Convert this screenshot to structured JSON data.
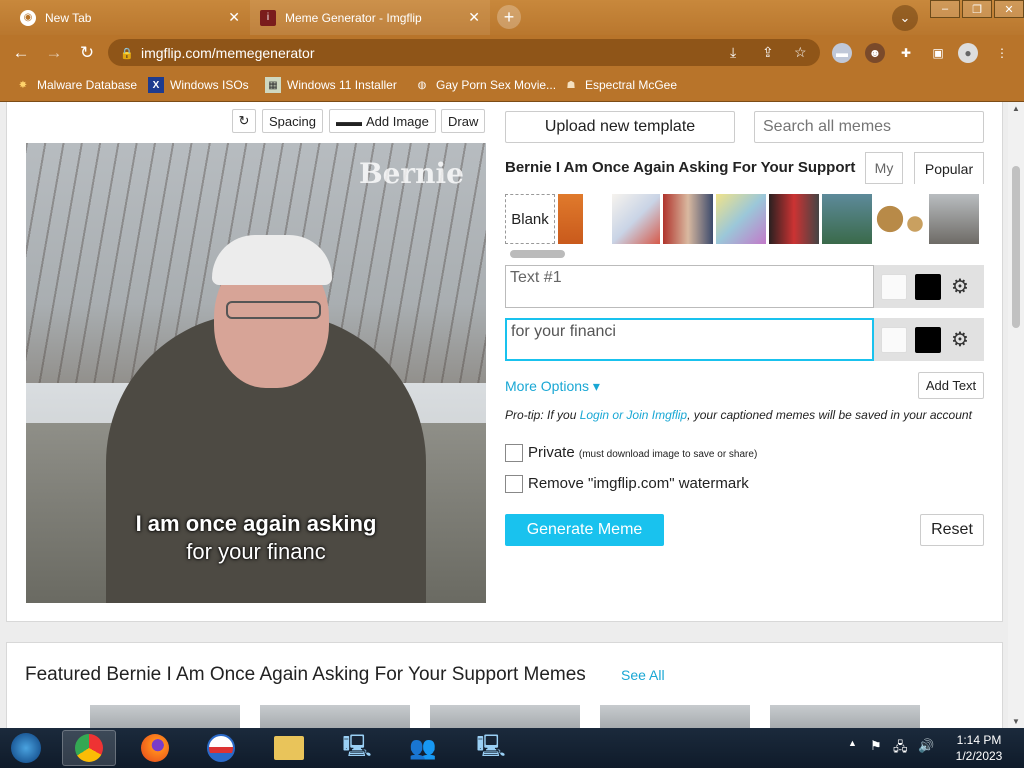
{
  "browser": {
    "tabs": [
      {
        "title": "New Tab"
      },
      {
        "title": "Meme Generator - Imgflip"
      }
    ],
    "url": "imgflip.com/memegenerator",
    "bookmarks": [
      {
        "label": "Malware Database"
      },
      {
        "label": "Windows ISOs"
      },
      {
        "label": "Windows 11 Installer"
      },
      {
        "label": "Gay Porn Sex Movie..."
      },
      {
        "label": "Espectral McGee"
      }
    ]
  },
  "editor": {
    "tools": {
      "spacing": "Spacing",
      "add_image": "Add Image",
      "draw": "Draw"
    },
    "meme_watermark_logo": "Bernie",
    "caption_line1": "I am once again asking",
    "caption_line2": "for your financ",
    "upload_label": "Upload new template",
    "search_placeholder": "Search all memes",
    "template_name": "Bernie I Am Once Again Asking For Your Support",
    "tab_my": "My",
    "tab_popular": "Popular",
    "blank_label": "Blank",
    "text1_placeholder": "Text #1",
    "text2_value": "for your financi",
    "more_options": "More Options ▾",
    "add_text": "Add Text",
    "protip_prefix": "Pro-tip: If you ",
    "protip_link": "Login or Join Imgflip",
    "protip_suffix": ", your captioned memes will be saved in your account",
    "private_label": "Private",
    "private_note": "(must download image to save or share)",
    "watermark_label": "Remove \"imgflip.com\" watermark",
    "generate_label": "Generate Meme",
    "reset_label": "Reset"
  },
  "featured": {
    "heading": "Featured Bernie I Am Once Again Asking For Your Support Memes",
    "see_all": "See All"
  },
  "taskbar": {
    "time": "1:14 PM",
    "date": "1/2/2023"
  },
  "colors": {
    "accent": "#19c2ee",
    "link": "#19a7d4",
    "chrome_theme": "#b8742a"
  }
}
